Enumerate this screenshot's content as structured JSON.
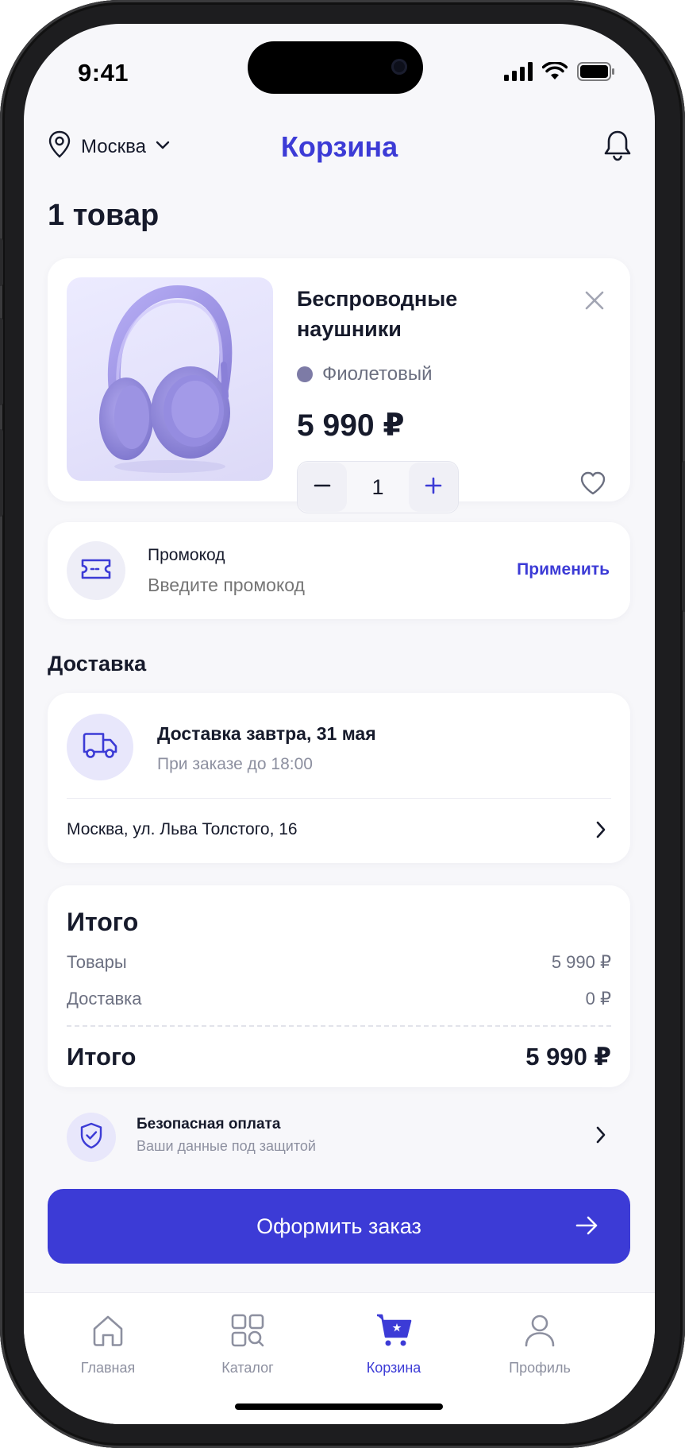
{
  "status_bar": {
    "time": "9:41"
  },
  "header": {
    "city": "Москва",
    "title": "Корзина"
  },
  "cart": {
    "count_label": "1 товар"
  },
  "product": {
    "name": "Беспроводные наушники",
    "color_name": "Фиолетовый",
    "color_hex": "#7d7ba6",
    "price": "5 990 ₽",
    "quantity": "1"
  },
  "promo": {
    "label": "Промокод",
    "placeholder": "Введите промокод",
    "apply_label": "Применить"
  },
  "delivery": {
    "section_title": "Доставка",
    "title": "Доставка завтра, 31 мая",
    "subtitle": "При заказе до 18:00",
    "address": "Москва, ул. Льва Толстого, 16"
  },
  "summary": {
    "heading": "Итого",
    "goods_label": "Товары",
    "goods_value": "5 990 ₽",
    "delivery_label": "Доставка",
    "delivery_value": "0 ₽",
    "total_label": "Итого",
    "total_value": "5 990 ₽"
  },
  "secure": {
    "title": "Безопасная оплата",
    "subtitle": "Ваши данные под защитой"
  },
  "checkout": {
    "label": "Оформить заказ"
  },
  "tabbar": {
    "items": [
      {
        "label": "Главная",
        "icon": "home-icon",
        "active": false
      },
      {
        "label": "Каталог",
        "icon": "catalog-icon",
        "active": false
      },
      {
        "label": "Корзина",
        "icon": "cart-icon",
        "active": true
      },
      {
        "label": "Профиль",
        "icon": "profile-icon",
        "active": false
      }
    ]
  },
  "colors": {
    "accent": "#3c3bd6",
    "background": "#f7f7fa",
    "text": "#161a2b",
    "muted": "#8d90a0"
  }
}
